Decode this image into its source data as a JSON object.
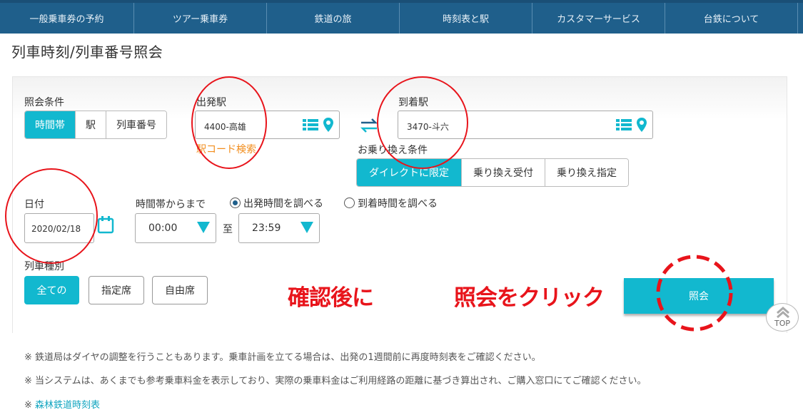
{
  "nav": {
    "items": [
      "一般乗車券の予約",
      "ツアー乗車券",
      "鉄道の旅",
      "時刻表と駅",
      "カスタマーサービス",
      "台鉄について"
    ]
  },
  "page": {
    "title": "列車時刻/列車番号照会"
  },
  "query": {
    "label": "照会条件",
    "options": [
      "時間帯",
      "駅",
      "列車番号"
    ],
    "selected": "時間帯"
  },
  "departure": {
    "label": "出発駅",
    "value": "4400-高雄",
    "code_search_link": "駅コード検索"
  },
  "arrival": {
    "label": "到着駅",
    "value": "3470-斗六"
  },
  "transfer": {
    "label": "お乗り換え条件",
    "options": [
      "ダイレクトに限定",
      "乗り換え受付",
      "乗り換え指定"
    ],
    "selected": "ダイレクトに限定"
  },
  "date": {
    "label": "日付",
    "value": "2020/02/18"
  },
  "time": {
    "label": "時間帯からまで",
    "radio_departure": "出発時間を調べる",
    "radio_arrival": "到着時間を調べる",
    "selected_radio": "出発時間を調べる",
    "from": "00:00",
    "separator": "至",
    "to": "23:59"
  },
  "train_type": {
    "label": "列車種別",
    "options": [
      "全ての",
      "指定席",
      "自由席"
    ],
    "selected": "全ての"
  },
  "search_button": "照会",
  "annotation": {
    "left": "確認後に",
    "right": "照会をクリック"
  },
  "top_button": "TOP",
  "notes": [
    "※ 鉄道局はダイヤの調整を行うこともあります。乗車計画を立てる場合は、出発の1週間前に再度時刻表をご確認ください。",
    "※ 当システムは、あくまでも参考乗車料金を表示しており、実際の乗車料金はご利用経路の距離に基づき算出され、ご購入窓口にてご確認ください。"
  ],
  "forest_link": {
    "prefix": "※ ",
    "text": "森林鉄道時刻表"
  },
  "colors": {
    "nav_bg": "#1f5f8b",
    "accent": "#12b8cf",
    "link_orange": "#f28d1c",
    "annotation_red": "#e8141b"
  }
}
